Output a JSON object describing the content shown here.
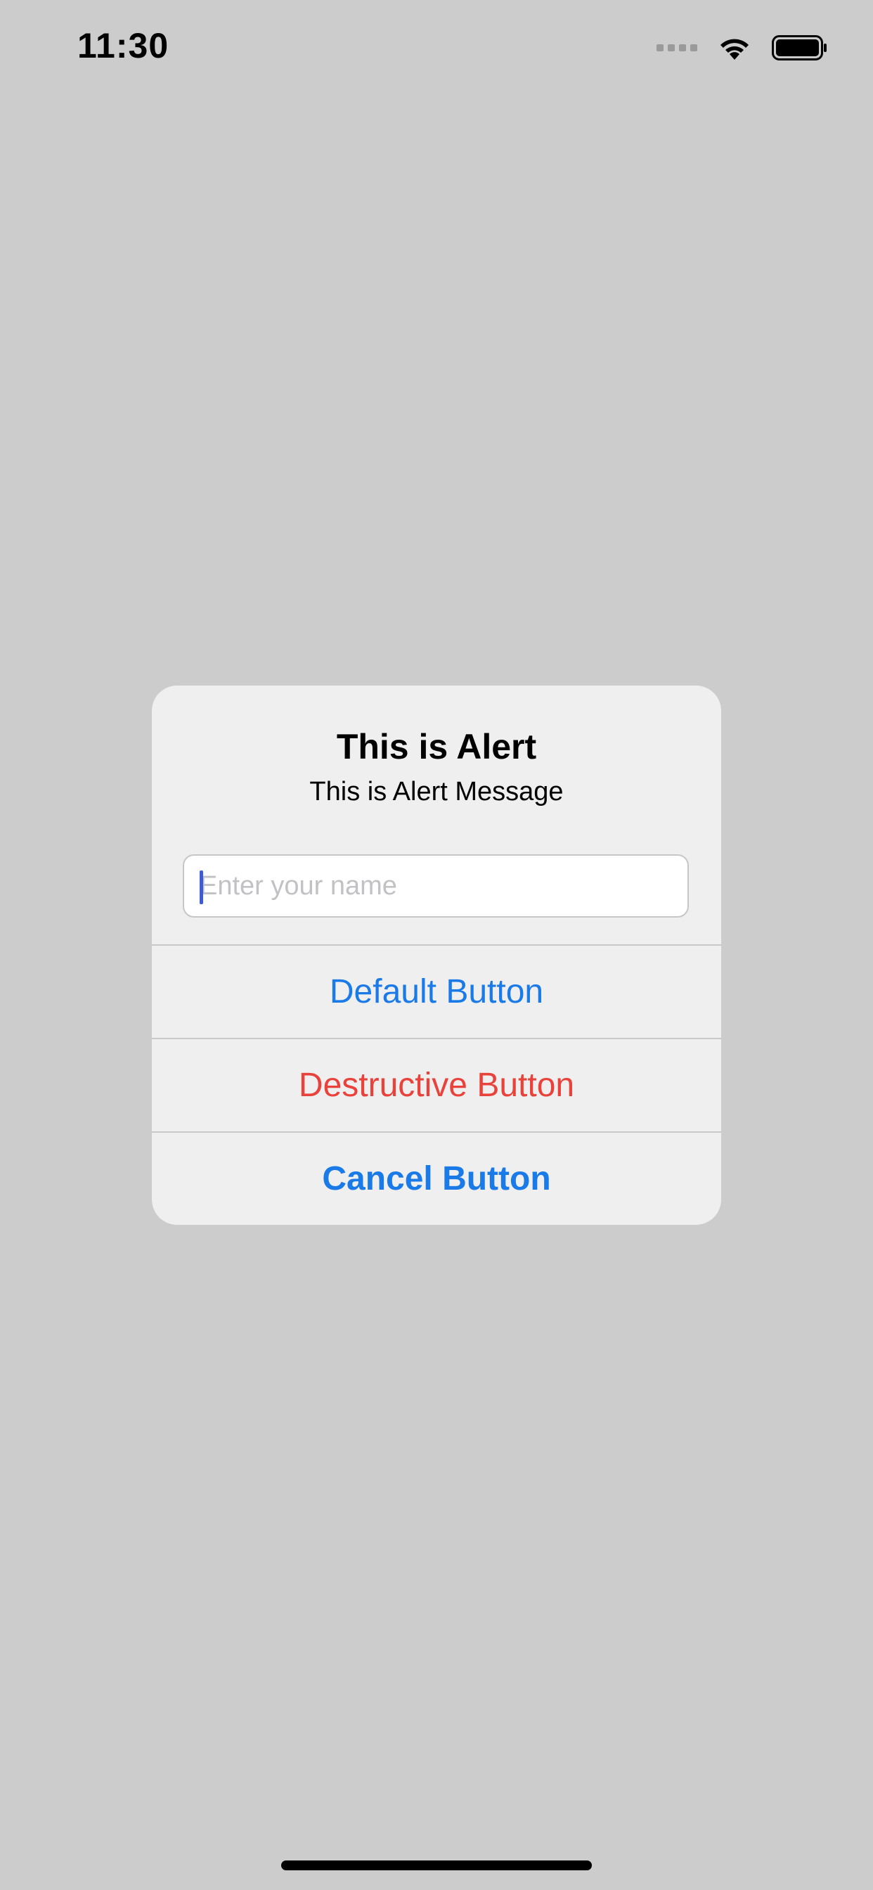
{
  "status_bar": {
    "time": "11:30",
    "icons": [
      "cellular-signal-icon",
      "wifi-icon",
      "battery-icon"
    ]
  },
  "alert": {
    "title": "This is Alert",
    "message": "This is Alert Message",
    "text_field": {
      "value": "",
      "placeholder": "Enter your name"
    },
    "buttons": {
      "default_label": "Default Button",
      "destructive_label": "Destructive Button",
      "cancel_label": "Cancel Button"
    }
  },
  "colors": {
    "background": "#cccccc",
    "alert_background": "#efefef",
    "accent_blue": "#1a7ae8",
    "destructive_red": "#e9423b",
    "caret": "#3b5bd9"
  }
}
